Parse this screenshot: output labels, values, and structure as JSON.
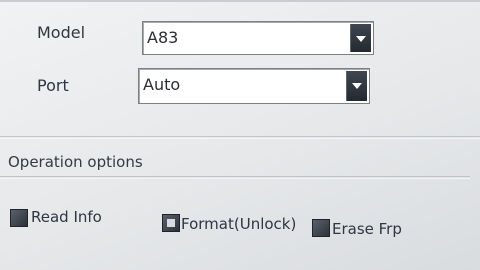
{
  "fields": {
    "model": {
      "label": "Model",
      "value": "A83"
    },
    "port": {
      "label": "Port",
      "value": "Auto"
    }
  },
  "operation_options": {
    "title": "Operation options",
    "read_info": {
      "label": "Read Info",
      "checked": false
    },
    "format_unlock": {
      "label": "Format(Unlock)",
      "checked": true
    },
    "erase_frp": {
      "label": "Erase Frp",
      "checked": false
    }
  },
  "icons": {
    "dropdown": "chevron-down-icon"
  }
}
